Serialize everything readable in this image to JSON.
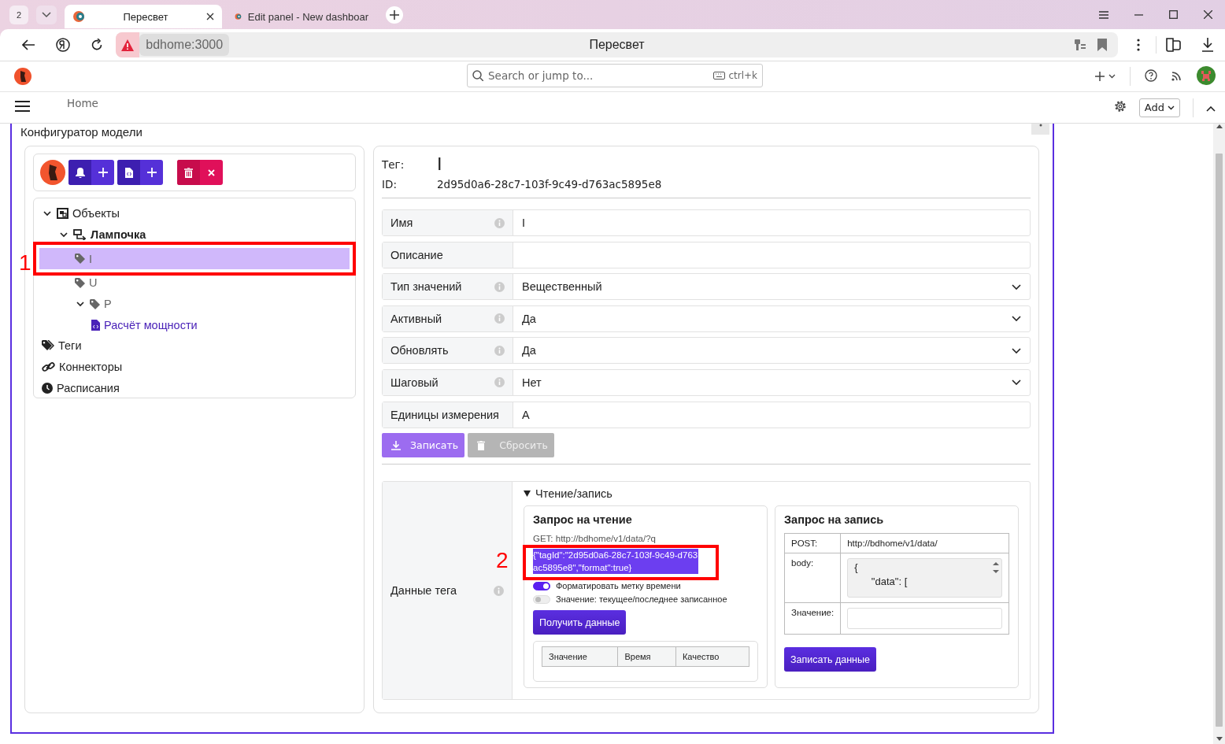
{
  "browser": {
    "tab_count": "2",
    "tabs": [
      {
        "title": "Пересвет",
        "selected": true
      },
      {
        "title": "Edit panel - New dashboar",
        "selected": false
      }
    ],
    "address": "bdhome:3000",
    "page_title": "Пересвет"
  },
  "app_header": {
    "search_placeholder": "Search or jump to...",
    "shortcut": "ctrl+k",
    "breadcrumb": "Home",
    "add_button": "Add"
  },
  "panel": {
    "title": "Конфигуратор модели",
    "tree": [
      {
        "label": "Объекты",
        "kind": "objects",
        "expanded": true,
        "selected": false,
        "children": [
          {
            "label": "Лампочка",
            "kind": "object",
            "expanded": true,
            "selected": false,
            "children": [
              {
                "label": "I",
                "kind": "tag",
                "selected": true
              },
              {
                "label": "U",
                "kind": "tag",
                "selected": false
              },
              {
                "label": "P",
                "kind": "tag",
                "expanded": true,
                "selected": false,
                "children": [
                  {
                    "label": "Расчёт мощности",
                    "kind": "script",
                    "selected": false
                  }
                ]
              }
            ]
          }
        ]
      },
      {
        "label": "Теги",
        "kind": "tags",
        "selected": false
      },
      {
        "label": "Коннекторы",
        "kind": "connectors",
        "selected": false
      },
      {
        "label": "Расписания",
        "kind": "schedules",
        "selected": false
      }
    ]
  },
  "tag": {
    "tag_label": "Тег:",
    "tag_value": "I",
    "id_label": "ID:",
    "id_value": "2d95d0a6-28c7-103f-9c49-d763ac5895e8",
    "fields": [
      {
        "label": "Имя",
        "info": true,
        "kind": "text",
        "value": "I"
      },
      {
        "label": "Описание",
        "info": false,
        "kind": "text"
      },
      {
        "label": "Тип значений",
        "info": true,
        "kind": "select",
        "value": "Вещественный"
      },
      {
        "label": "Активный",
        "info": true,
        "kind": "select",
        "value": "Да"
      },
      {
        "label": "Обновлять",
        "info": true,
        "kind": "select",
        "value": "Да"
      },
      {
        "label": "Шаговый",
        "info": true,
        "kind": "select",
        "value": "Нет"
      },
      {
        "label": "Единицы измерения",
        "info": false,
        "kind": "text",
        "value": "A"
      }
    ],
    "buttons": [
      {
        "label": "Записать",
        "kind": "save"
      },
      {
        "label": "Сбросить",
        "kind": "reset"
      }
    ]
  },
  "tag_data": {
    "label": "Данные тега",
    "info": true,
    "section_title": "Чтение/запись",
    "expanded": true,
    "read": {
      "title": "Запрос на чтение",
      "get_line": "GET: http://bdhome/v1/data/?q",
      "query": "{\"tagId\":\"2d95d0a6-28c7-103f-9c49-d763ac5895e8\",\"format\":true}",
      "query_selected": true,
      "toggles": [
        {
          "label": "Форматировать метку времени",
          "on": true
        },
        {
          "label": "Значение: текущее/последнее записанное",
          "on": false
        }
      ],
      "button": "Получить данные",
      "columns": [
        "Значение",
        "Время",
        "Качество"
      ]
    },
    "write": {
      "title": "Запрос на запись",
      "rows": [
        {
          "label": "POST:",
          "kind": "text",
          "value": "http://bdhome/v1/data/"
        },
        {
          "label": "body:",
          "kind": "textarea",
          "value": "{\n      \"data\": ["
        },
        {
          "label": "Значение:",
          "kind": "input"
        }
      ],
      "button": "Записать данные"
    }
  },
  "annotations": {
    "tree_selection": "1",
    "read_query": "2"
  }
}
